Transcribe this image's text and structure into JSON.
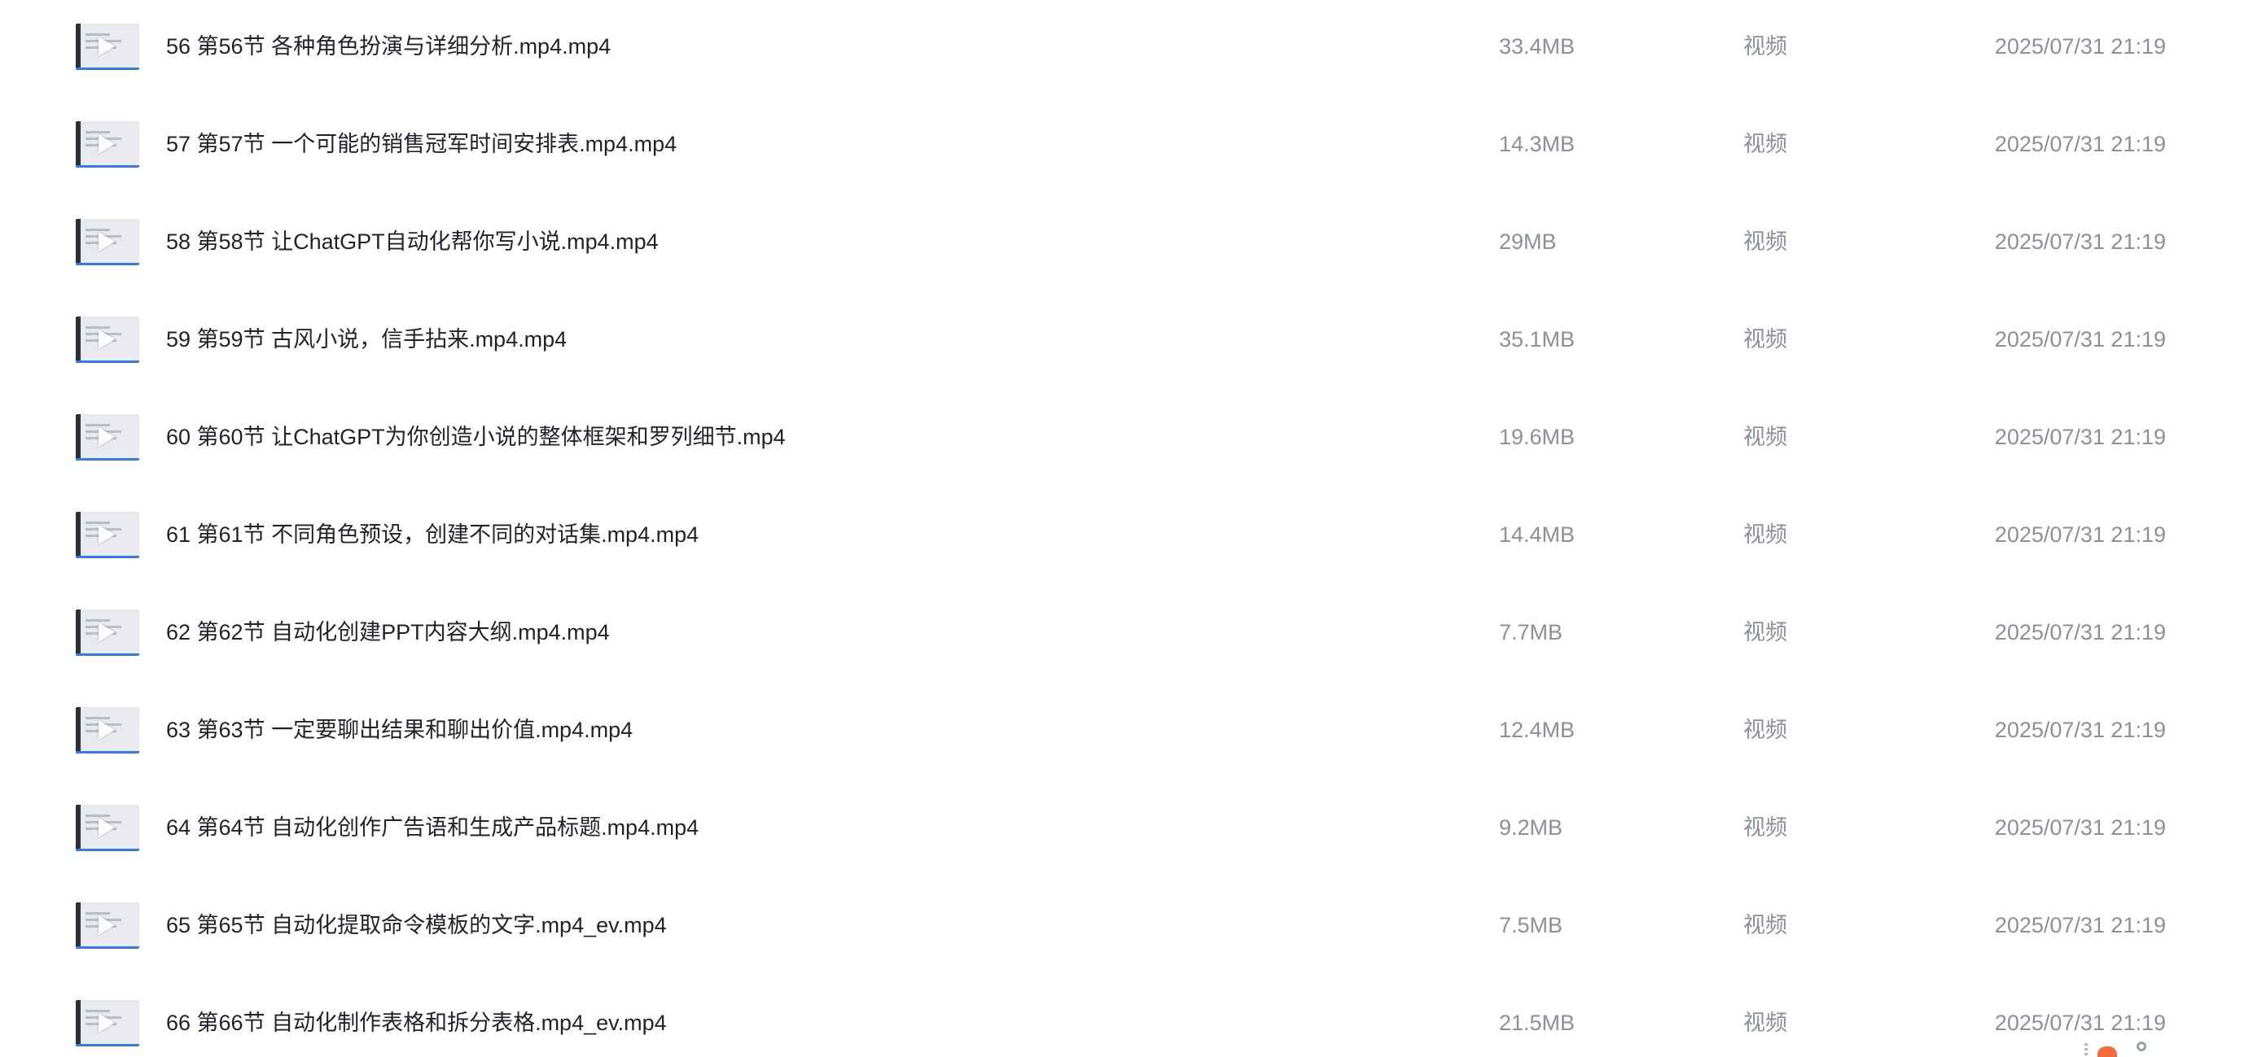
{
  "files": [
    {
      "name": "56 第56节  各种角色扮演与详细分析.mp4.mp4",
      "size": "33.4MB",
      "type": "视频",
      "date": "2025/07/31 21:19"
    },
    {
      "name": "57 第57节  一个可能的销售冠军时间安排表.mp4.mp4",
      "size": "14.3MB",
      "type": "视频",
      "date": "2025/07/31 21:19"
    },
    {
      "name": "58 第58节  让ChatGPT自动化帮你写小说.mp4.mp4",
      "size": "29MB",
      "type": "视频",
      "date": "2025/07/31 21:19"
    },
    {
      "name": "59 第59节  古风小说，信手拈来.mp4.mp4",
      "size": "35.1MB",
      "type": "视频",
      "date": "2025/07/31 21:19"
    },
    {
      "name": "60 第60节  让ChatGPT为你创造小说的整体框架和罗列细节.mp4",
      "size": "19.6MB",
      "type": "视频",
      "date": "2025/07/31 21:19"
    },
    {
      "name": "61 第61节  不同角色预设，创建不同的对话集.mp4.mp4",
      "size": "14.4MB",
      "type": "视频",
      "date": "2025/07/31 21:19"
    },
    {
      "name": "62 第62节  自动化创建PPT内容大纲.mp4.mp4",
      "size": "7.7MB",
      "type": "视频",
      "date": "2025/07/31 21:19"
    },
    {
      "name": "63 第63节  一定要聊出结果和聊出价值.mp4.mp4",
      "size": "12.4MB",
      "type": "视频",
      "date": "2025/07/31 21:19"
    },
    {
      "name": "64 第64节  自动化创作广告语和生成产品标题.mp4.mp4",
      "size": "9.2MB",
      "type": "视频",
      "date": "2025/07/31 21:19"
    },
    {
      "name": "65 第65节  自动化提取命令模板的文字.mp4_ev.mp4",
      "size": "7.5MB",
      "type": "视频",
      "date": "2025/07/31 21:19"
    },
    {
      "name": "66 第66节  自动化制作表格和拆分表格.mp4_ev.mp4",
      "size": "21.5MB",
      "type": "视频",
      "date": "2025/07/31 21:19"
    }
  ],
  "icons": {
    "thumbnail": "video-thumbnail-icon",
    "play": "play-icon",
    "corner": "floating-assistant-icon"
  },
  "colors": {
    "name_text": "#1f2329",
    "meta_text": "#8a8f99",
    "accent": "#3a7bd5",
    "corner_accent": "#f26b3a"
  }
}
